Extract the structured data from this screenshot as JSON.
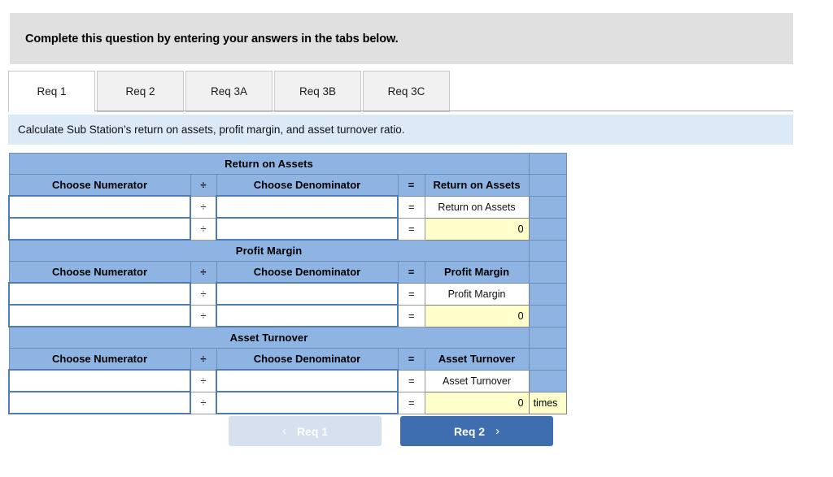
{
  "banner": {
    "text": "Complete this question by entering your answers in the tabs below."
  },
  "tabs": [
    {
      "label": "Req 1",
      "active": true
    },
    {
      "label": "Req 2",
      "active": false
    },
    {
      "label": "Req 3A",
      "active": false
    },
    {
      "label": "Req 3B",
      "active": false
    },
    {
      "label": "Req 3C",
      "active": false
    }
  ],
  "instruction": {
    "text": "Calculate Sub Station’s return on assets, profit margin, and asset turnover ratio."
  },
  "worksheet": {
    "columns": {
      "numerator": "Choose Numerator",
      "divide": "÷",
      "denominator": "Choose Denominator",
      "equals": "=",
      "divide_symbol": "÷",
      "equals_symbol": "="
    },
    "sections": [
      {
        "title": "Return on Assets",
        "result_header": "Return on Assets",
        "label_row": {
          "numerator": "",
          "denominator": "",
          "label": "Return on Assets"
        },
        "value_row": {
          "numerator": "",
          "denominator": "",
          "value": "0",
          "unit": ""
        }
      },
      {
        "title": "Profit Margin",
        "result_header": "Profit Margin",
        "label_row": {
          "numerator": "",
          "denominator": "",
          "label": "Profit Margin"
        },
        "value_row": {
          "numerator": "",
          "denominator": "",
          "value": "0",
          "unit": ""
        }
      },
      {
        "title": "Asset Turnover",
        "result_header": "Asset Turnover",
        "label_row": {
          "numerator": "",
          "denominator": "",
          "label": "Asset Turnover"
        },
        "value_row": {
          "numerator": "",
          "denominator": "",
          "value": "0",
          "unit": "times"
        }
      }
    ]
  },
  "nav": {
    "prev_label": "Req 1",
    "prev_chevron": "‹",
    "next_label": "Req 2",
    "next_chevron": "›"
  },
  "colors": {
    "header_blue": "#8db4e2",
    "result_yellow": "#ffffcc",
    "instruction_blue": "#dce9f7",
    "banner_gray": "#e0e0e0",
    "next_button_blue": "#3e6db0",
    "prev_button_blue": "#d6e0ee"
  }
}
